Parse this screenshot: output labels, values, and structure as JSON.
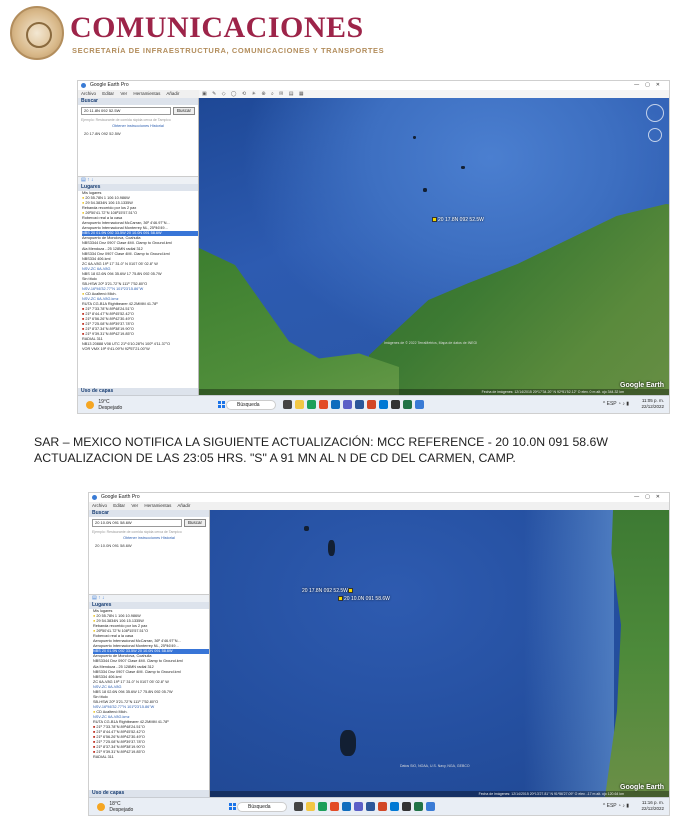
{
  "header": {
    "brand": "COMUNICACIONES",
    "subtitle": "SECRETARÍA DE INFRAESTRUCTURA, COMUNICACIONES Y TRANSPORTES"
  },
  "caption": {
    "line1": "SAR – MEXICO NOTIFICA LA SIGUIENTE ACTUALIZACIÓN: MCC REFERENCE - 20 10.0N 091 58.6W",
    "line2": "ACTUALIZACION DE LAS 23:05 HRS. \"S\" A 91 MN AL N DE CD DEL CARMEN, CAMP."
  },
  "shot1": {
    "app_title": "Google Earth Pro",
    "menu": [
      "Archivo",
      "Editar",
      "Ver",
      "Herramientas",
      "Añadir",
      "Ayuda"
    ],
    "search_header": "Buscar",
    "search_value": "20 11.8N 092 52.5W",
    "search_button": "Buscar",
    "search_hint": "Ejemplo: Restaurante de comida rápida cerca de Tampico",
    "links": "Obtener instrucciones   Historial",
    "result": "20 17.8N 092 52.5W",
    "places_header": "Lugares",
    "places": [
      "Mis lugares",
      "20 55.78N 1 106 10.986W",
      "29 54.3834N 106 15.1335W",
      "Rebanda recorrido por los 2 pax",
      "26º50'41.72\"N 108º15'57.51\"O",
      "Roberozó real a la casa",
      "Aeropuerto Internacional McCarran, 36º 4'46.97\"N...",
      "Aeropuerto Internacional Monterrey NL, 25º46'49...",
      "NBS 20 01.9N 092 33.5W 20 10.0N 091 58.6W",
      "Aeropuerto de Monclova, Coahuila",
      "NBS3344 Dnz 0907 Clase 4MI. Clamp to Ground.kml",
      "Ala Mendoza - 25 128MN radial 312",
      "NBS334 Dnz 0907 Clase 4MI. Clamp to Ground.kml",
      "NBS334 406.kml",
      "ZC 6A-V8G 19º 17' 31.0\" N 0107 05' 02.8\" W",
      "NSV-ZC 6A-V8G",
      "NBS 18 02.6N 094 35.6W 17 75.8N 092 05.7W",
      "Sin título",
      "SB-HSW 20º 3'21.72\"N 111º 7'52.80\"O",
      "NSV-16º46'32.77\"N 101º23'15.86\"W",
      "CD Acaltenó Mich.",
      "NSV-ZC 6A-V8G.kmz",
      "RUTA CG-B1A Rightbearer 42.2MMM 41.78º",
      "21º 7'33.78\"N 89º48'24.51\"O",
      "21º 8'44.47\"N 89º45'52.42\"O",
      "21º 6'56.26\"N 89º42'30.49\"O",
      "21º 7'25.08\"N 89º39'37.78\"O",
      "21º 8'37.34\"N 89º38'19.90\"O",
      "21º 9'39.31\"N 89º42'19.85\"O",
      "RADIAL 311",
      "NB13 20888 V08 UTC 21º 6'10.28\"N 100º 4'11.37\"O",
      "VOR VMX 19º 9'41.09\"N 92º57'21.00\"W"
    ],
    "layers_header": "Uso de capas",
    "map_marker": "20 17.8N 092 52.5W",
    "map_brand": "Google Earth",
    "map_credit": "Imágenes de © 2022 TerraMetrics, Mapa de datos de INEGI",
    "status_line": "Fecha de imágenes: 12/14/2015   20º17'34.20\" N  92º51'52.12\" O  elev. 0 m  alt. ojo 344.32 km",
    "weather_temp": "19°C",
    "weather_desc": "Despejado",
    "taskbar_search": "Búsqueda",
    "tray_lang": "ESP",
    "time": "11:05 p. m.",
    "date": "22/12/2022"
  },
  "shot2": {
    "app_title": "Google Earth Pro",
    "menu": [
      "Archivo",
      "Editar",
      "Ver",
      "Herramientas",
      "Añadir",
      "Ayuda"
    ],
    "search_header": "Buscar",
    "search_value": "20 10.0N 091 58.6W",
    "search_button": "Buscar",
    "search_hint": "Ejemplo: Restaurante de comida rápida cerca de Tampico",
    "links": "Obtener instrucciones   Historial",
    "result": "20 10.0N 091 58.6W",
    "places_header": "Lugares",
    "places": [
      "Mis lugares",
      "20 55.78N 1 106 10.986W",
      "29 54.3834N 106 15.1335W",
      "Rebanda recorrido por los 2 pax",
      "26º50'41.72\"N 108º15'57.51\"O",
      "Roberozó real a la casa",
      "Aeropuerto Internacional McCarran, 36º 4'46.97\"N...",
      "Aeropuerto Internacional Monterrey NL, 25º46'49...",
      "NBS 20 01.9N 092 33.5W 20 10.0N 091 58.6W",
      "Aeropuerto de Monclova, Coahuila",
      "NBS3344 Dnz 0907 Clase 4MI. Clamp to Ground.kml",
      "Ala Mendoza - 25 128MN radial 312",
      "NBS334 Dnz 0907 Clase 4MI. Clamp to Ground.kml",
      "NBS334 406.kml",
      "ZC 6A-V8G 19º 17' 31.0\" N 0107 05' 02.8\" W",
      "NSV-ZC 6A-V8G",
      "NBS 18 02.6N 094 35.6W 17 75.8N 092 05.7W",
      "Sin título",
      "SB-HSW 20º 3'21.72\"N 111º 7'52.80\"O",
      "NSV-16º46'32.77\"N 101º23'15.86\"W",
      "CD Acaltenó Mich.",
      "NSV-ZC 6A-V8G.kmz",
      "RUTA CG-B1A Rightbearer 42.2MMM 41.78º",
      "21º 7'33.78\"N 89º48'24.51\"O",
      "21º 8'44.47\"N 89º45'52.42\"O",
      "21º 6'56.26\"N 89º42'30.49\"O",
      "21º 7'25.08\"N 89º39'37.78\"O",
      "21º 8'37.34\"N 89º38'19.90\"O",
      "21º 9'39.31\"N 89º42'19.85\"O",
      "RADIAL 311"
    ],
    "layers_header": "Uso de capas",
    "map_marker_a": "20 17.8N 092 52.5W",
    "map_marker_b": "20 10.0N 091 58.6W",
    "map_brand": "Google Earth",
    "map_credit": "Datos SIO, NOAA, U.S. Navy, NGA, GEBCO",
    "status_line": "Fecha de imágenes: 12/14/2015   20º13'27.81\" N  91º56'27.09\" O  elev. -17 m  alt. ojo 120.64 km",
    "weather_temp": "18°C",
    "weather_desc": "Despejado",
    "taskbar_search": "Búsqueda",
    "tray_lang": "ESP",
    "time": "11:16 p. m.",
    "date": "22/12/2022"
  }
}
